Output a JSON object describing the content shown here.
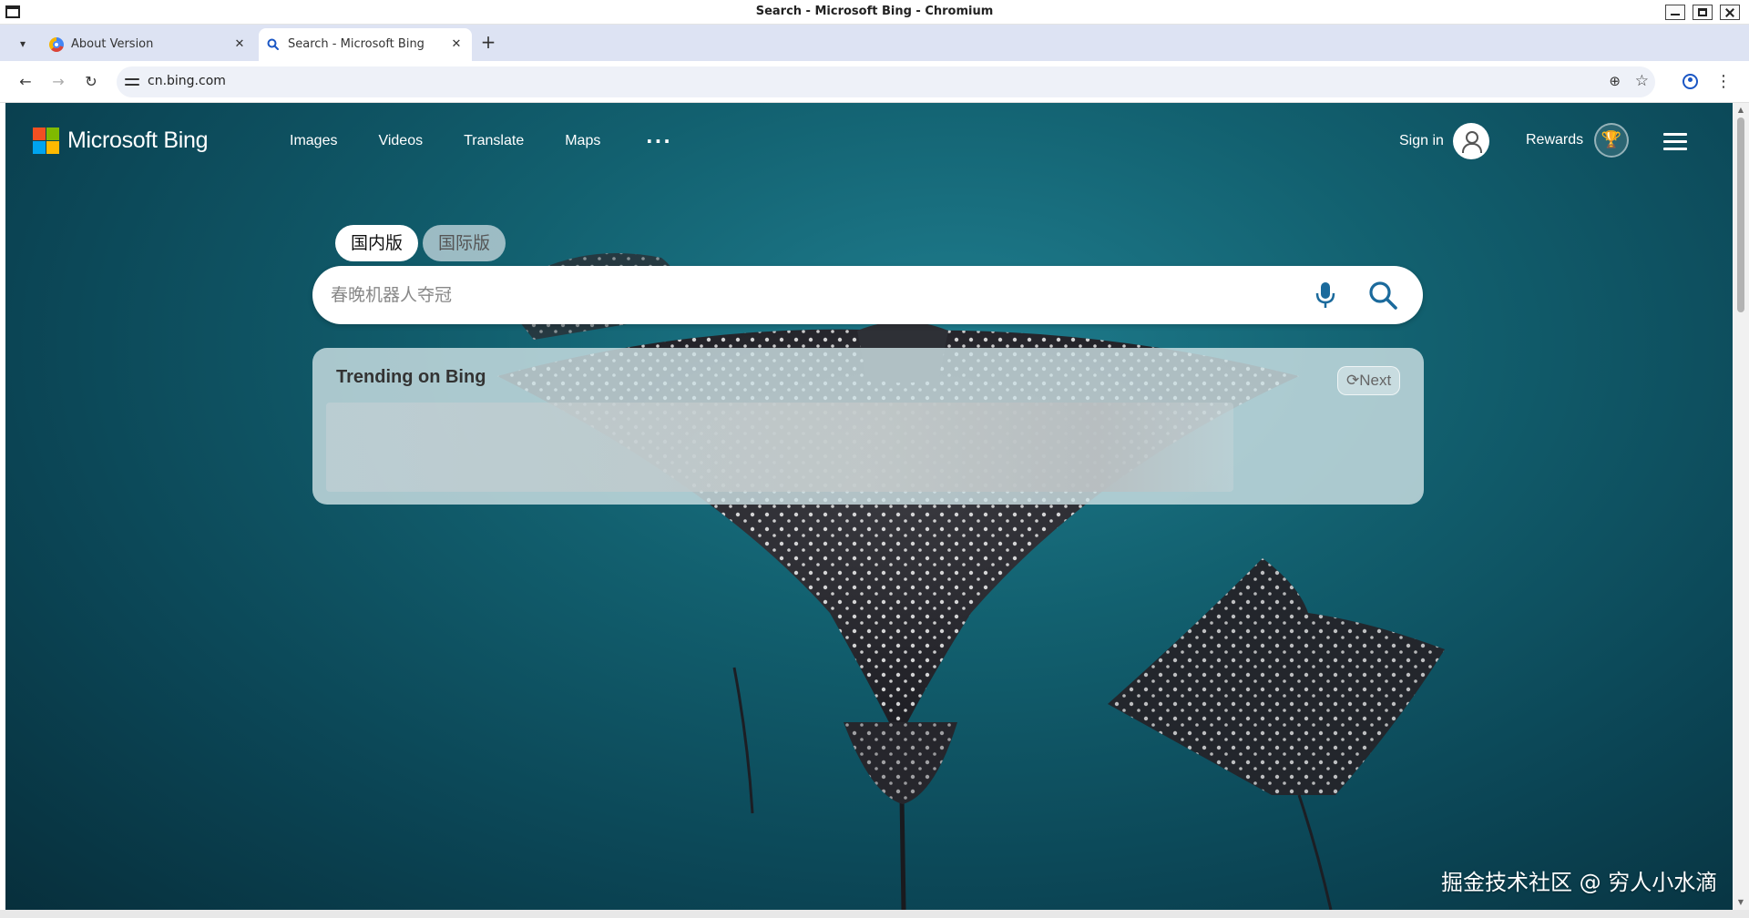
{
  "window": {
    "title": "Search - Microsoft Bing - Chromium"
  },
  "tabs": [
    {
      "title": "About Version",
      "favicon": "chromium-icon"
    },
    {
      "title": "Search - Microsoft Bing",
      "favicon": "search-icon"
    }
  ],
  "toolbar": {
    "url": "cn.bing.com"
  },
  "bing": {
    "logo_text": "Microsoft Bing",
    "logo_colors": [
      "#f25022",
      "#7fba00",
      "#00a4ef",
      "#ffb900"
    ],
    "nav": [
      "Images",
      "Videos",
      "Translate",
      "Maps"
    ],
    "more": "···",
    "signin_label": "Sign in",
    "rewards_label": "Rewards",
    "scope_tabs": [
      "国内版",
      "国际版"
    ],
    "search_placeholder": "春晚机器人夺冠",
    "trending_title": "Trending on Bing",
    "next_label": "Next"
  },
  "watermark": "掘金技术社区 @ 穷人小水滴"
}
